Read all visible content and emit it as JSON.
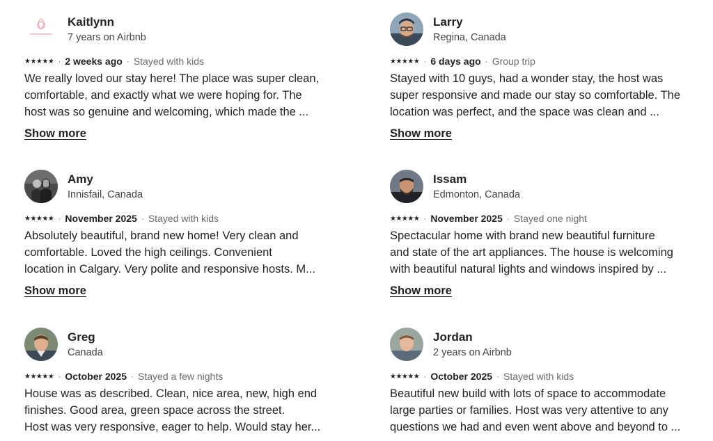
{
  "reviews": [
    {
      "name": "Kaitlynn",
      "meta": "7 years on Airbnb",
      "avatar": "logo-avatar",
      "stars": "★★★★★",
      "when": "2 weeks ago",
      "trip": "Stayed with kids",
      "lines": [
        "We really loved our stay here! The place was super clean,",
        "comfortable, and exactly what we were hoping for. The",
        "host was so genuine and welcoming, which made the ..."
      ],
      "show_more": "Show more"
    },
    {
      "name": "Larry",
      "meta": "Regina, Canada",
      "avatar": "person-avatar",
      "stars": "★★★★★",
      "when": "6 days ago",
      "trip": "Group trip",
      "lines": [
        "Stayed with 10 guys, had a wonder stay, the host was",
        "super responsive and made our stay so comfortable. The",
        "location was perfect, and the space was clean and ..."
      ],
      "show_more": "Show more"
    },
    {
      "name": "Amy",
      "meta": "Innisfail, Canada",
      "avatar": "couple-avatar",
      "stars": "★★★★★",
      "when": "November 2025",
      "trip": "Stayed with kids",
      "lines": [
        "Absolutely beautiful, brand new home! Very clean and",
        "comfortable. Loved the high ceilings. Convenient",
        "location in Calgary. Very polite and responsive hosts. M..."
      ],
      "show_more": "Show more"
    },
    {
      "name": "Issam",
      "meta": "Edmonton, Canada",
      "avatar": "person-avatar",
      "stars": "★★★★★",
      "when": "November 2025",
      "trip": "Stayed one night",
      "lines": [
        "Spectacular home with brand new beautiful furniture",
        "and state of the art appliances. The house is welcoming",
        "with beautiful natural lights and windows inspired by ..."
      ],
      "show_more": "Show more"
    },
    {
      "name": "Greg",
      "meta": "Canada",
      "avatar": "person-avatar",
      "stars": "★★★★★",
      "when": "October 2025",
      "trip": "Stayed a few nights",
      "lines": [
        "House was as described. Clean, nice area, new, high end",
        "finishes. Good area, green space across the street.",
        "Host was very responsive, eager to help. Would stay her..."
      ],
      "show_more": ""
    },
    {
      "name": "Jordan",
      "meta": "2 years on Airbnb",
      "avatar": "person-avatar",
      "stars": "★★★★★",
      "when": "October 2025",
      "trip": "Stayed with kids",
      "lines": [
        "Beautiful new build with lots of space to accommodate",
        "large parties or families. Host was very attentive to any",
        "questions we had and even went above and beyond to ..."
      ],
      "show_more": ""
    }
  ],
  "separator": "·",
  "colors": {
    "text": "#222222",
    "muted": "#6a6a6a",
    "logo_accent": "#e8a0a8"
  }
}
